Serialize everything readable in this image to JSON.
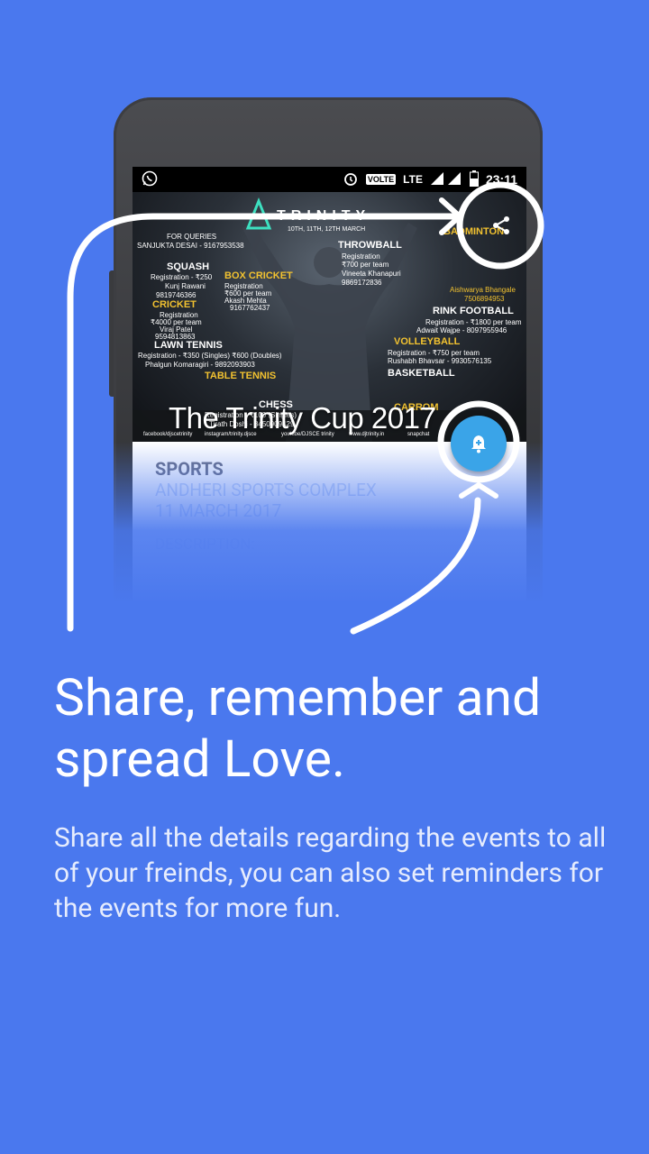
{
  "status_bar": {
    "network": "LTE",
    "volte": "VOLTE",
    "time": "23:11"
  },
  "event": {
    "title": "The Trinity Cup 2017",
    "category": "SPORTS",
    "venue": "ANDHERI SPORTS COMPLEX",
    "date": "11 MARCH 2017",
    "description_label": "DESCRIPTION:"
  },
  "poster": {
    "brand": "TRINITY",
    "dates": "10TH, 11TH, 12TH MARCH",
    "queries": "FOR QUERIES",
    "contact": "SANJUKTA DESAI - 9167953538",
    "left_items": [
      {
        "name": "SQUASH",
        "lines": [
          "Registration - ₹250",
          "Kunj Rawani",
          "9819746366"
        ]
      },
      {
        "name": "CRICKET",
        "lines": [
          "Registration",
          "₹4000 per team",
          "Viraj Patel",
          "9594813863"
        ]
      },
      {
        "name": "LAWN TENNIS",
        "lines": [
          "Registration - ₹350 (Singles) ₹600 (Doubles)",
          "Phalgun Komaragiri - 9892093903"
        ]
      },
      {
        "name": "TABLE TENNIS",
        "lines": []
      },
      {
        "name": "CHESS",
        "lines": [
          "Registration - ₹100 (Singles)",
          "Tirath Doshi - 8450909429"
        ]
      }
    ],
    "middle_items": [
      {
        "name": "BOX CRICKET",
        "lines": [
          "Registration",
          "₹600 per team",
          "Akash Mehta",
          "9167762437"
        ]
      },
      {
        "name": "THROWBALL",
        "lines": [
          "Registration",
          "₹700 per team",
          "Vineeta Khanapuri",
          "9869172836"
        ]
      }
    ],
    "right_items": [
      {
        "name": "BADMINTON",
        "lines": [
          "Aishwarya Bhangale",
          "7506894953"
        ]
      },
      {
        "name": "RINK FOOTBALL",
        "lines": [
          "Registration - ₹1800 per team",
          "Adwait Wajpe - 8097955946"
        ]
      },
      {
        "name": "VOLLEYBALL",
        "lines": [
          "Registration - ₹750 per team",
          "Rushabh Bhavsar - 9930576135"
        ]
      },
      {
        "name": "BASKETBALL",
        "lines": []
      },
      {
        "name": "CARROM",
        "lines": []
      }
    ],
    "footer": [
      "facebook/djscetrinity",
      "instagram/trinity.djsce",
      "youtube/DJSCE trinity",
      "www.djtrinity.in",
      "snapchat"
    ]
  },
  "onboarding": {
    "headline": "Share, remember and spread Love.",
    "body": "Share all the details regarding the events to all of your freinds, you can also set reminders for the events for more fun."
  },
  "colors": {
    "background": "#4a78ee",
    "fab": "#3aa4e8",
    "category_text": "#6a6f86"
  },
  "icons": {
    "share": "share-icon",
    "reminder": "bell-plus-icon",
    "whatsapp": "whatsapp-icon",
    "alarm": "alarm-icon"
  }
}
